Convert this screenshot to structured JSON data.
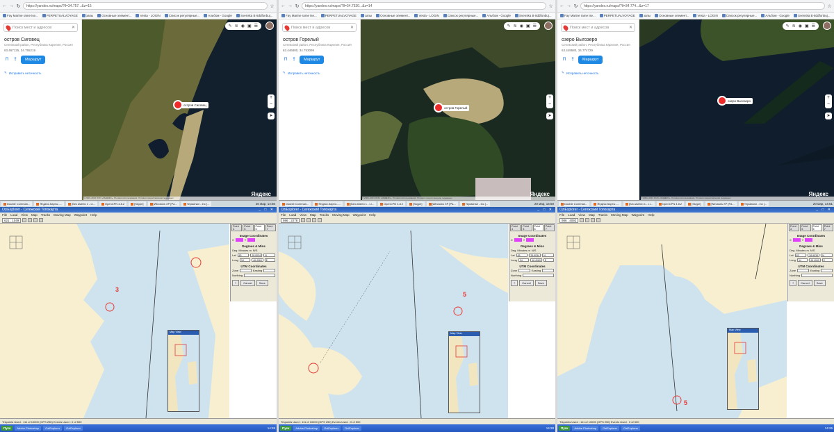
{
  "columns": [
    {
      "url": "https://yandex.ru/maps/?ll=34.757...&z=15",
      "bookmarks": [
        "Fay Marine rame ise...",
        "PERPETUALVOYAGE",
        "запы",
        "Основные элемент...",
        "Vesta - LOGIN",
        "Список регулярные...",
        "Альбом - Google",
        "Svenska B·8ddfonbuj...",
        "Мультимедиа"
      ],
      "search_placeholder": "Поиск мест и адресов",
      "place_name": "остров Сиговец",
      "place_region": "Сегежский район, Республика Карелия, Россия",
      "place_coords": "63.467125, 34.755219",
      "route_label": "Маршрут",
      "fix_label": "Исправить неточность",
      "marker_label": "остров Сиговец",
      "map_logo": "Яндекс",
      "copyright": "© 2003–2021 ООО «ЯНДЕКС», Условия использования, Условия предоставления геоданных",
      "taskbar": [
        "Double Comman...",
        "Яндекс.Карты -...",
        "[Без имени 1 - Li...",
        "OpenCPN 4.8.2",
        "[Skype]",
        "[Windows XP [Pa...",
        "Терминал - lnc [..."
      ],
      "clock": "20 мар, 14:50",
      "ozi_title": "OziExplorer - Сегежский Топокарта",
      "ozi_menu": [
        "File",
        "Load",
        "View",
        "Map",
        "Tracks",
        "Moving Map",
        "Waypoint",
        "Help"
      ],
      "ozi_position": "621 : 1049",
      "point_tabs": [
        "Point 4",
        "Point 5",
        "Point 6",
        "Point 7"
      ],
      "image_coord_label": "Image Coordinates",
      "degmin_label": "Degrees & Mins",
      "deg_label": "Deg",
      "min_label": "Minutes m",
      "ns_label": "N/S",
      "ew_label": "E/W",
      "lat_label": "Lat",
      "long_label": "Long",
      "lat_deg": "63",
      "lat_min": "28.0034",
      "lat_hem": "N",
      "long_deg": "34",
      "long_min": "46.4069",
      "long_hem": "E",
      "utm_label": "UTM Coordinates",
      "zone_label": "Zone",
      "easting_label": "Easting",
      "northing_label": "Northing",
      "cancel_label": "Cancel",
      "save_label": "Save",
      "statusbar": "Trkpoints Used : 111 of 10000  (GPS 250)     Events Used : 0 of 500",
      "mapview_title": "Map View",
      "waypoint_number": "3",
      "ozi_taskbar": [
        "Пуск",
        "Adobe Photoshop",
        "OziExplorer",
        "OziExplorer"
      ],
      "ozi_clock": "14:26"
    },
    {
      "url": "https://yandex.ru/maps/?ll=34.7530...&z=14",
      "bookmarks": [
        "Fay Marine rame ise...",
        "PERPETUALVOYAGE",
        "запы",
        "Основные элемент...",
        "Vesta - LOGIN",
        "Список регулярные...",
        "Альбом - Google",
        "Svenska B·8ddfonbuj...",
        "Мультимедиа"
      ],
      "search_placeholder": "Поиск мест и адресов",
      "place_name": "остров Горелый",
      "place_region": "Сегежский район, Республика Карелия, Россия",
      "place_coords": "63.446880, 34.753099",
      "route_label": "Маршрут",
      "fix_label": "Исправить неточность",
      "marker_label": "остров Горелый",
      "map_logo": "Яндекс",
      "copyright": "© 2003–2021 ООО «ЯНДЕКС», Условия использования, Условия предоставления геоданных",
      "taskbar": [
        "Double Comman...",
        "Яндекс.Карты -...",
        "[Без имени 1 - Li...",
        "OpenCPN 4.8.2",
        "[Skype]",
        "[Windows XP [Pa...",
        "Терминал - lnc [..."
      ],
      "clock": "20 мар, 14:50",
      "ozi_title": "OziExplorer - Сегежский Топокарта",
      "ozi_menu": [
        "File",
        "Load",
        "View",
        "Map",
        "Tracks",
        "Moving Map",
        "Waypoint",
        "Help"
      ],
      "ozi_position": "986 : 2278",
      "point_tabs": [
        "Point 4",
        "Point 5",
        "Point 6",
        "Point 7"
      ],
      "image_coord_label": "Image Coordinates",
      "degmin_label": "Degrees & Mins",
      "deg_label": "Deg",
      "min_label": "Minutes m",
      "ns_label": "N/S",
      "ew_label": "E/W",
      "lat_label": "Lat",
      "long_label": "Long",
      "lat_deg": "63",
      "lat_min": "26.9034",
      "lat_hem": "N",
      "long_deg": "34",
      "long_min": "46.4069",
      "long_hem": "E",
      "utm_label": "UTM Coordinates",
      "zone_label": "Zone",
      "easting_label": "Easting",
      "northing_label": "Northing",
      "cancel_label": "Cancel",
      "save_label": "Save",
      "statusbar": "Trkpoints Used : 111 of 10000  (GPS 250)     Events Used : 0 of 500",
      "mapview_title": "Map View",
      "waypoint_number": "5",
      "ozi_taskbar": [
        "Пуск",
        "Adobe Photoshop",
        "OziExplorer",
        "OziExplorer"
      ],
      "ozi_clock": "14:28"
    },
    {
      "url": "https://yandex.ru/maps/?ll=34.774...&z=17",
      "bookmarks": [
        "Fay Marine rame ise...",
        "PERPETUALVOYAGE",
        "запы",
        "Основные элемент...",
        "Vesta - LOGIN",
        "Список регулярные...",
        "Альбом - Google",
        "Svenska B·8ddfonbuj...",
        "Мультимедиа"
      ],
      "search_placeholder": "Поиск мест и адресов",
      "place_name": "озеро Выгозеро",
      "place_region": "Сегежский район, Республика Карелия, Россия",
      "place_coords": "63.449580, 34.774729",
      "route_label": "Маршрут",
      "fix_label": "Исправить неточность",
      "marker_label": "озеро Выгозеро",
      "map_logo": "Яндекс",
      "copyright": "© 2003–2021 ООО «ЯНДЕКС», Условия использования, Условия предоставления геоданных",
      "taskbar": [
        "Double Comman...",
        "Яндекс.Карты -...",
        "[Без имени 1 - Li...",
        "OpenCPN 4.8.2",
        "[Skype]",
        "[Windows XP [Pa...",
        "Терминал - lnc [..."
      ],
      "clock": "20 мар, 14:51",
      "ozi_title": "OziExplorer - Сегежский Топокарта",
      "ozi_menu": [
        "File",
        "Load",
        "View",
        "Map",
        "Tracks",
        "Moving Map",
        "Waypoint",
        "Help"
      ],
      "ozi_position": "986 : 4092",
      "point_tabs": [
        "Point 4",
        "Point 5",
        "Point 6",
        "Point 7"
      ],
      "image_coord_label": "Image Coordinates",
      "degmin_label": "Degrees & Mins",
      "deg_label": "Deg",
      "min_label": "Minutes m",
      "ns_label": "N/S",
      "ew_label": "E/W",
      "lat_label": "Lat",
      "long_label": "Long",
      "lat_deg": "63",
      "lat_min": "26.9034",
      "lat_hem": "N",
      "long_deg": "34",
      "long_min": "46.4069",
      "long_hem": "E",
      "utm_label": "UTM Coordinates",
      "zone_label": "Zone",
      "easting_label": "Easting",
      "northing_label": "Northing",
      "cancel_label": "Cancel",
      "save_label": "Save",
      "statusbar": "Trkpoints Used : 111 of 10000  (GPS 250)     Events Used : 0 of 500",
      "mapview_title": "Map View",
      "waypoint_number": "5",
      "ozi_taskbar": [
        "Пуск",
        "Adobe Photoshop",
        "OziExplorer",
        "OziExplorer"
      ],
      "ozi_clock": "14:26"
    }
  ],
  "colors": {
    "satellite_land": "#5a5a35",
    "satellite_water": "#0f1d2e",
    "chart_land": "#f7efcf",
    "chart_water": "#cfe3ef",
    "marker": "#ee2b2b",
    "accent": "#1e88e5"
  }
}
